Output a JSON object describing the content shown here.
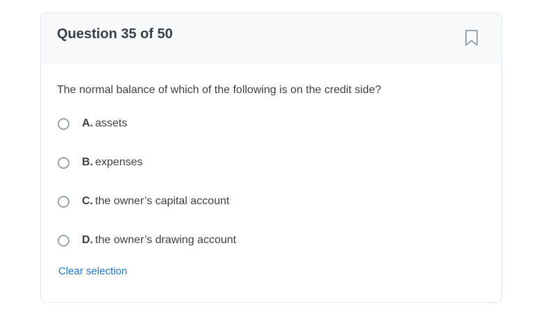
{
  "header": {
    "title": "Question 35 of 50",
    "bookmark_icon": "bookmark-icon"
  },
  "question": {
    "text": "The normal balance of which of the following is on the credit side?"
  },
  "options": [
    {
      "letter": "A.",
      "text": "assets"
    },
    {
      "letter": "B.",
      "text": "expenses"
    },
    {
      "letter": "C.",
      "text": "the owner’s capital account"
    },
    {
      "letter": "D.",
      "text": "the owner’s drawing account"
    }
  ],
  "clear_label": "Clear selection",
  "colors": {
    "text": "#3a4047",
    "link": "#1f73d1",
    "header_bg": "#f8f9fa",
    "radio_border": "#9ba3ab"
  }
}
